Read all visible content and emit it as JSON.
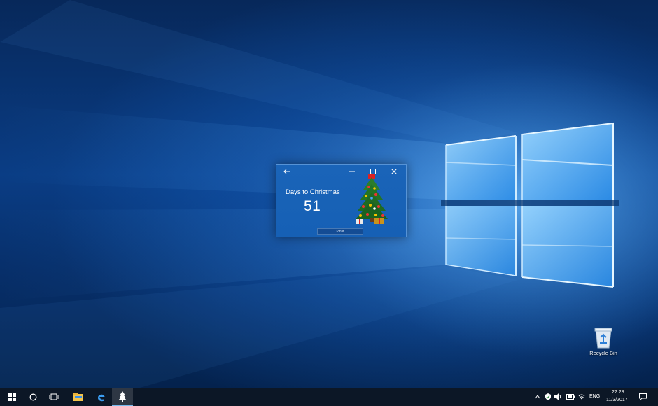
{
  "app": {
    "heading": "Days to Christmas",
    "days_remaining": "51",
    "pin_button_label": "Pin it",
    "icons": {
      "back": "back-arrow-icon",
      "minimize": "minimize-icon",
      "maximize": "maximize-icon",
      "close": "close-icon",
      "image": "christmas-tree-image"
    }
  },
  "desktop": {
    "recycle_bin_label": "Recycle Bin"
  },
  "taskbar": {
    "apps": [
      "start-icon",
      "search-circle-icon",
      "task-view-icon",
      "file-explorer-icon",
      "edge-icon",
      "christmas-tree-app-icon"
    ],
    "language": "ENG",
    "time": "22:28",
    "date": "11/3/2017",
    "tray_icons": [
      "show-hidden-icons-chevron",
      "defender-icon",
      "volume-icon",
      "battery-icon",
      "wifi-icon",
      "action-center-icon"
    ]
  },
  "colors": {
    "window_bg": "#1660b5",
    "taskbar_bg": "#0c1726",
    "desktop_blue": "#0a3d85",
    "accent": "#76b9ed"
  }
}
